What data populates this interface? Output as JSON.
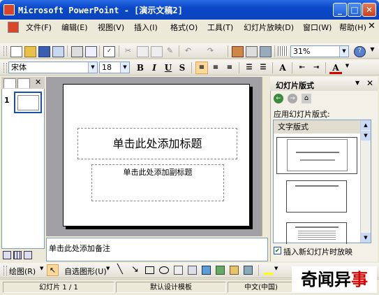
{
  "window": {
    "title": "Microsoft PowerPoint - [演示文稿2]"
  },
  "menu": [
    "文件(F)",
    "编辑(E)",
    "视图(V)",
    "插入(I)",
    "格式(O)",
    "工具(T)",
    "幻灯片放映(D)",
    "窗口(W)",
    "帮助(H)"
  ],
  "standard_toolbar": {
    "zoom": "31%"
  },
  "format_toolbar": {
    "font": "宋体",
    "font_size": "18",
    "bold": "B",
    "italic": "I",
    "underline": "U",
    "shadow": "S"
  },
  "slide_panel": {
    "slide_number": "1"
  },
  "slide": {
    "title_placeholder": "单击此处添加标题",
    "subtitle_placeholder": "单击此处添加副标题"
  },
  "notes": {
    "placeholder": "单击此处添加备注"
  },
  "task_pane": {
    "title": "幻灯片版式",
    "apply_label": "应用幻灯片版式:",
    "section": "文字版式",
    "checkbox_label": "插入新幻灯片时放映",
    "checkbox_checked": true
  },
  "draw_toolbar": {
    "draw_label": "绘图(R)",
    "autoshapes_label": "自选图形(U)"
  },
  "statusbar": {
    "slide_info": "幻灯片 1 / 1",
    "template": "默认设计模板",
    "language": "中文(中国)"
  },
  "watermark": {
    "text": "奇闻异事"
  },
  "colors": {
    "titlebar": "#0a48c8",
    "watermark_accent": "#d80000"
  }
}
